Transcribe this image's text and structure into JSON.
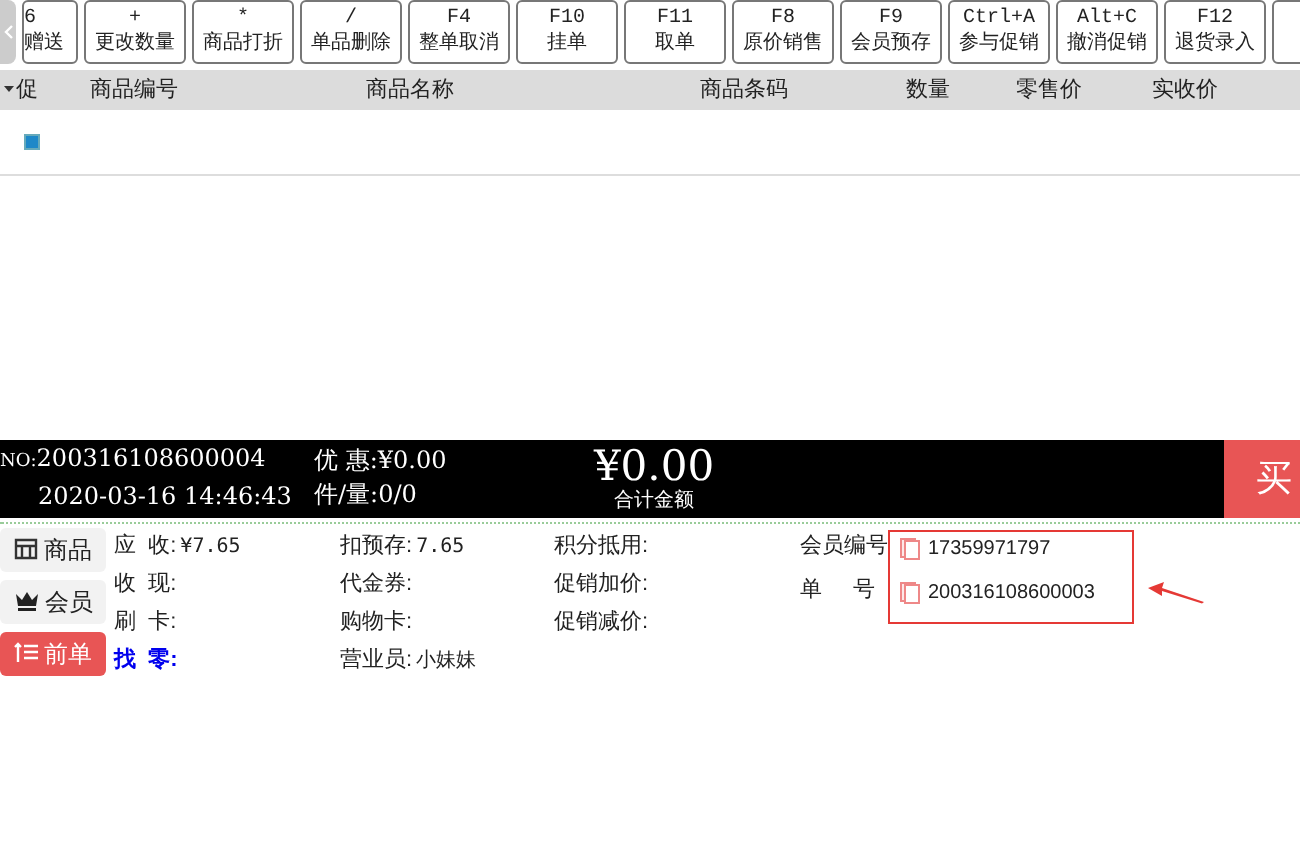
{
  "toolbar": {
    "buttons": [
      {
        "key": "6",
        "label": "赠送"
      },
      {
        "key": "+",
        "label": "更改数量"
      },
      {
        "key": "*",
        "label": "商品打折"
      },
      {
        "key": "/",
        "label": "单品删除"
      },
      {
        "key": "F4",
        "label": "整单取消"
      },
      {
        "key": "F10",
        "label": "挂单"
      },
      {
        "key": "F11",
        "label": "取单"
      },
      {
        "key": "F8",
        "label": "原价销售"
      },
      {
        "key": "F9",
        "label": "会员预存"
      },
      {
        "key": "Ctrl+A",
        "label": "参与促销"
      },
      {
        "key": "Alt+C",
        "label": "撤消促销"
      },
      {
        "key": "F12",
        "label": "退货录入"
      }
    ]
  },
  "table": {
    "columns": [
      "促",
      "商品编号",
      "商品名称",
      "商品条码",
      "数量",
      "零售价",
      "实收价"
    ],
    "rows": [
      {
        "selected": true
      }
    ]
  },
  "summary": {
    "order_no_label": "NO:",
    "order_no": "200316108600004",
    "datetime": "2020-03-16 14:46:43",
    "discount": "优 惠:¥0.00",
    "quantity": "件/量:0/0",
    "total": "¥0.00",
    "total_label": "合计金额",
    "checkout_button": "买"
  },
  "side_tabs": [
    {
      "kind": "goods",
      "label": "商品",
      "selected": false
    },
    {
      "kind": "member",
      "label": "会员",
      "selected": false
    },
    {
      "kind": "previous",
      "label": "前单",
      "selected": true
    }
  ],
  "payment": {
    "columns": [
      [
        {
          "label": "应  收:",
          "value": "¥7.65",
          "emphasis": false
        },
        {
          "label": "收  现:",
          "emphasis": false
        },
        {
          "label": "刷  卡:",
          "emphasis": false
        },
        {
          "label": "找  零:",
          "emphasis": true
        }
      ],
      [
        {
          "label": "扣预存:",
          "value": "7.65",
          "emphasis": false
        },
        {
          "label": "代金券:",
          "emphasis": false
        },
        {
          "label": "购物卡:",
          "emphasis": false
        },
        {
          "label": "营业员:",
          "value": "小妹妹",
          "emphasis": false
        }
      ],
      [
        {
          "label": "积分抵用:",
          "emphasis": false
        },
        {
          "label": "促销加价:",
          "emphasis": false
        },
        {
          "label": "促销减价:",
          "emphasis": false
        }
      ]
    ]
  },
  "member_info": [
    {
      "label": "会员编号",
      "value": "17359971797"
    },
    {
      "label": "单     号",
      "value": "200316108600003"
    }
  ]
}
